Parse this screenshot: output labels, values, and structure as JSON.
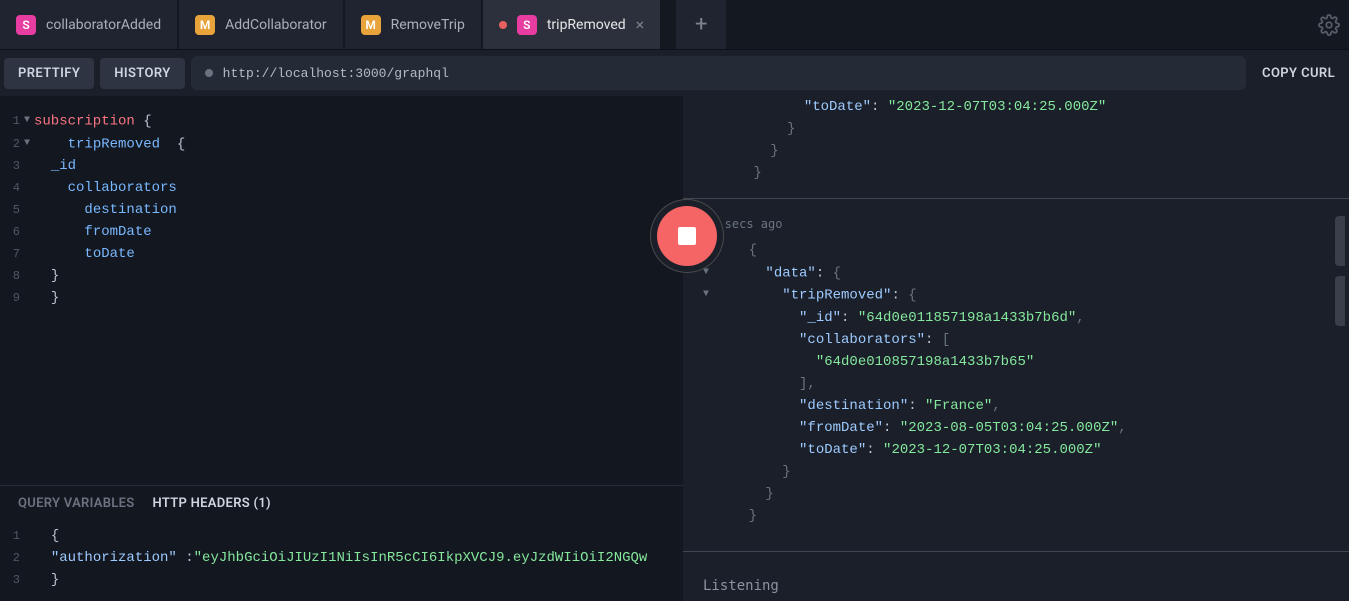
{
  "tabs": [
    {
      "badge": "S",
      "label": "collaboratorAdded",
      "dirty": false,
      "closeable": false,
      "active": false
    },
    {
      "badge": "M",
      "label": "AddCollaborator",
      "dirty": false,
      "closeable": false,
      "active": false
    },
    {
      "badge": "M",
      "label": "RemoveTrip",
      "dirty": false,
      "closeable": false,
      "active": false
    },
    {
      "badge": "S",
      "label": "tripRemoved",
      "dirty": true,
      "closeable": true,
      "active": true
    }
  ],
  "toolbar": {
    "prettify": "PRETTIFY",
    "history": "HISTORY",
    "url": "http://localhost:3000/graphql",
    "copy_curl": "COPY CURL"
  },
  "query": {
    "lines": [
      {
        "n": "1",
        "fold": true,
        "keyword": "subscription",
        "suffix": " {"
      },
      {
        "n": "2",
        "fold": true,
        "indent": "    ",
        "field": "tripRemoved",
        "suffix": "  {"
      },
      {
        "n": "3",
        "indent": "  ",
        "field": "_id"
      },
      {
        "n": "4",
        "indent": "    ",
        "field": "collaborators"
      },
      {
        "n": "5",
        "indent": "      ",
        "field": "destination"
      },
      {
        "n": "6",
        "indent": "      ",
        "field": "fromDate"
      },
      {
        "n": "7",
        "indent": "      ",
        "field": "toDate"
      },
      {
        "n": "8",
        "indent": "  ",
        "punc": "}"
      },
      {
        "n": "9",
        "indent": "  ",
        "punc": "}"
      }
    ]
  },
  "vars": {
    "tab_vars": "QUERY VARIABLES",
    "tab_headers": "HTTP HEADERS (1)",
    "lines": [
      {
        "n": "1",
        "indent": "  ",
        "punc": "{"
      },
      {
        "n": "2",
        "indent": "  ",
        "key": "\"authorization\"",
        "colon": " :",
        "val": "\"eyJhbGciOiJIUzI1NiIsInR5cCI6IkpXVCJ9.eyJzdWIiOiI2NGQw"
      },
      {
        "n": "3",
        "indent": "  ",
        "punc": "}"
      }
    ]
  },
  "results": {
    "top_fragment": [
      {
        "indent": "            ",
        "key": "\"toDate\"",
        "colon": ": ",
        "val": "\"2023-12-07T03:04:25.000Z\""
      },
      {
        "indent": "          ",
        "punc": "}"
      },
      {
        "indent": "        ",
        "punc": "}"
      },
      {
        "indent": "      ",
        "punc": "}"
      }
    ],
    "timestamp": "11 secs ago",
    "main": {
      "data": {
        "tripRemoved": {
          "_id": "64d0e011857198a1433b7b6d",
          "collaborators": [
            "64d0e010857198a1433b7b65"
          ],
          "destination": "France",
          "fromDate": "2023-08-05T03:04:25.000Z",
          "toDate": "2023-12-07T03:04:25.000Z"
        }
      }
    },
    "listening": "Listening"
  },
  "icons": {
    "close": "×",
    "plus": "+",
    "fold": "▼"
  }
}
